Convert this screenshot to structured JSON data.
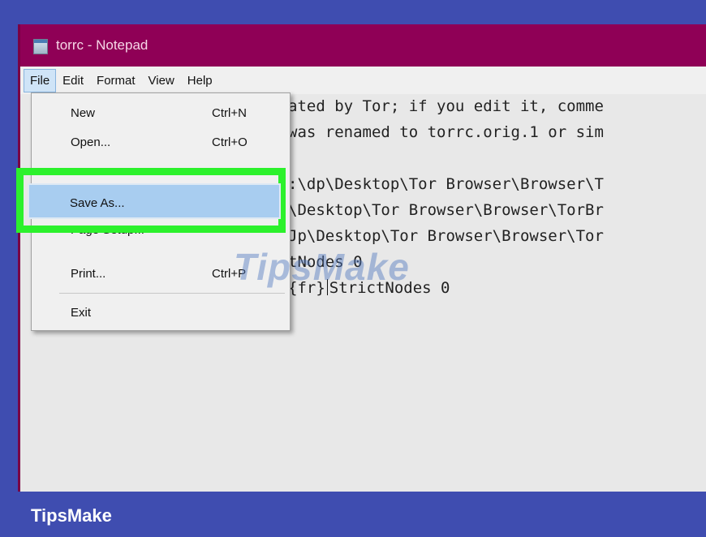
{
  "window": {
    "title": "torrc - Notepad"
  },
  "menubar": [
    "File",
    "Edit",
    "Format",
    "View",
    "Help"
  ],
  "editor_lines": [
    "ated by Tor; if you edit it, comme",
    "was renamed to torrc.orig.1 or sim",
    ":\\dp\\Desktop\\Tor Browser\\Browser\\T",
    "\\Desktop\\Tor Browser\\Browser\\TorBr",
    "Jp\\Desktop\\Tor Browser\\Browser\\Tor",
    "tNodes 0",
    "{fr}",
    "StrictNodes 0"
  ],
  "file_menu": {
    "new": {
      "label": "New",
      "shortcut": "Ctrl+N"
    },
    "open": {
      "label": "Open...",
      "shortcut": "Ctrl+O"
    },
    "save_as": {
      "label": "Save As..."
    },
    "page_setup": {
      "label": "Page Setup..."
    },
    "print": {
      "label": "Print...",
      "shortcut": "Ctrl+P"
    },
    "exit": {
      "label": "Exit"
    }
  },
  "watermark": "TipsMake",
  "brand": "TipsMake",
  "colors": {
    "titlebar": "#8f0056",
    "highlight": "#2cf12c",
    "selection": "#a8cdf0",
    "footer": "#3f4db0"
  }
}
